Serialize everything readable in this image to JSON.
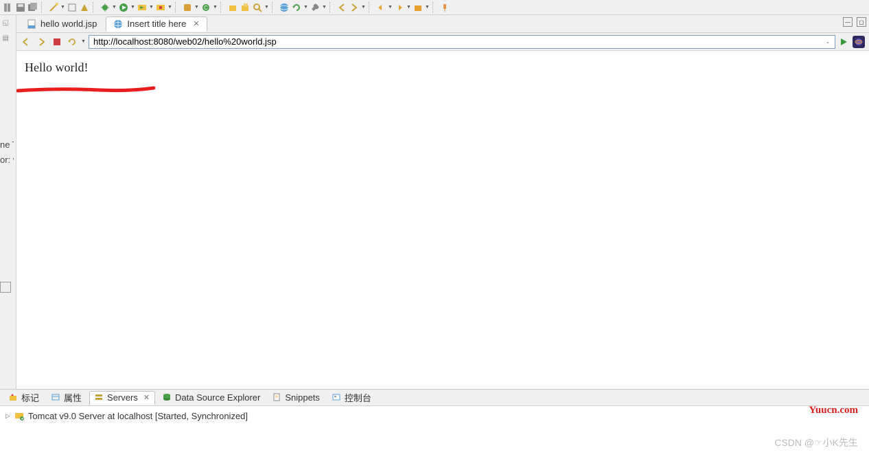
{
  "tabs": {
    "file_tab": "hello world.jsp",
    "browser_tab": "Insert title here"
  },
  "url": "http://localhost:8080/web02/hello%20world.jsp",
  "page_content": "Hello world!",
  "left_clip": {
    "line1": "ne T",
    "line2": "or: v"
  },
  "bottom_tabs": {
    "markers": "标记",
    "properties": "属性",
    "servers": "Servers",
    "dse": "Data Source Explorer",
    "snippets": "Snippets",
    "console": "控制台"
  },
  "server_row": "Tomcat v9.0 Server at localhost  [Started, Synchronized]",
  "watermarks": {
    "yuucn": "Yuucn.com",
    "csdn": "CSDN @☞小K先生"
  }
}
